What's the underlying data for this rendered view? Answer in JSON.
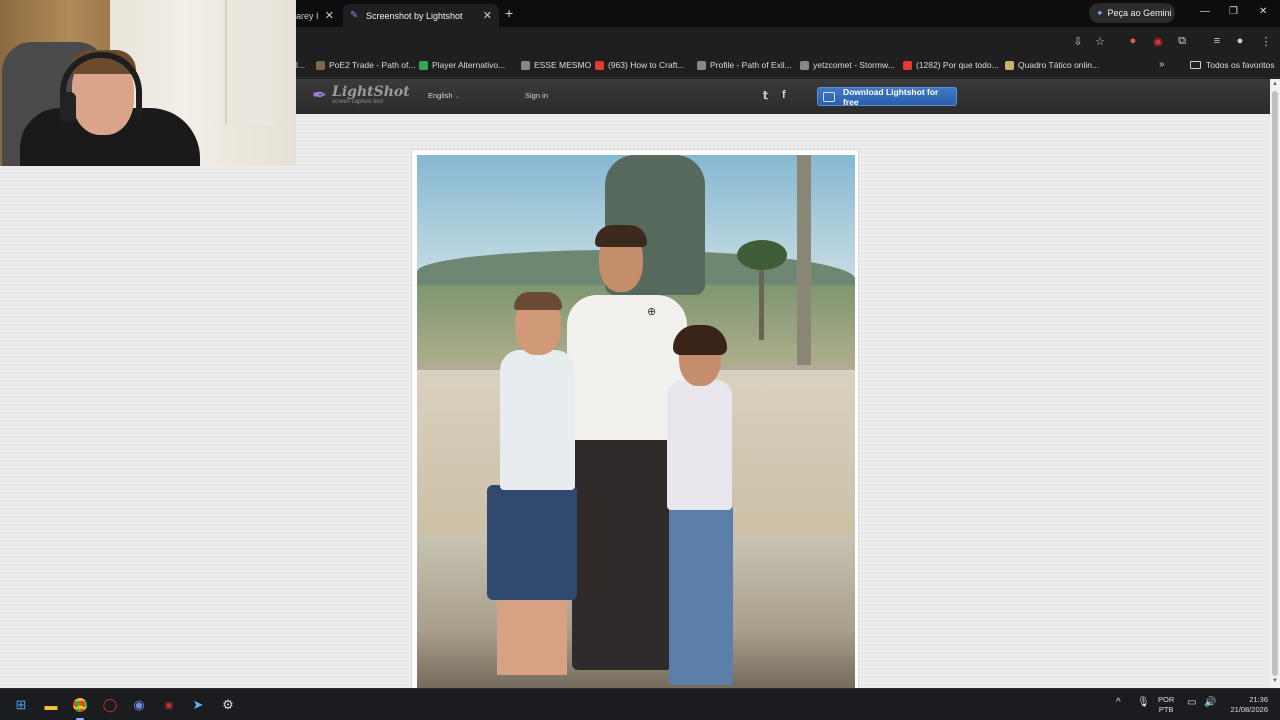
{
  "browser": {
    "tabs": [
      {
        "label": "arey I",
        "active": false
      },
      {
        "label": "Screenshot by Lightshot",
        "active": true
      }
    ],
    "gemini_button": "Peça ao Gemini",
    "bookmarks": [
      {
        "label": "PoE2 Trade - Path of...",
        "icon": "poe-icon",
        "color": "#7a6a4a"
      },
      {
        "label": "Player Alternativo...",
        "icon": "green-icon",
        "color": "#35a853"
      },
      {
        "label": "ESSE MESMO",
        "icon": "poe-icon",
        "color": "#888888"
      },
      {
        "label": "(963) How to Craft...",
        "icon": "youtube-icon",
        "color": "#e53935"
      },
      {
        "label": "Profile - Path of Exil...",
        "icon": "poe-icon",
        "color": "#888888"
      },
      {
        "label": "yetzcomet - Stormw...",
        "icon": "poe-icon",
        "color": "#888888"
      },
      {
        "label": "(1282) Por que todo...",
        "icon": "youtube-icon",
        "color": "#e53935"
      },
      {
        "label": "Quadro Tático onlin...",
        "icon": "board-icon",
        "color": "#c9b36b"
      }
    ],
    "all_bookmarks": "Todos os favoritos"
  },
  "lightshot": {
    "logo_title": "LightShot",
    "logo_tagline": "screen capture tool",
    "language": "English",
    "signin": "Sign in",
    "download_button": "Download Lightshot for free"
  },
  "taskbar": {
    "language_line1": "POR",
    "language_line2": "PTB",
    "time": "21:36",
    "date": "21/08/2026"
  },
  "colors": {
    "download_accent": "#2c5ea8",
    "page_bg": "#ececec",
    "taskbar_bg": "#1b1c20"
  }
}
